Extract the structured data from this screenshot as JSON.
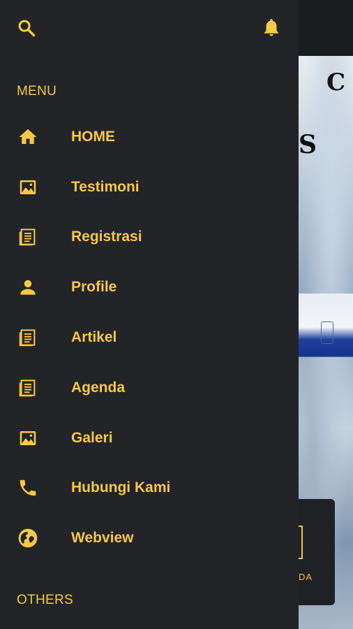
{
  "drawer": {
    "header": {
      "search_icon": "search-icon",
      "notification_icon": "bell-icon"
    },
    "menu_section_title": "MENU",
    "menu_items": [
      {
        "label": "HOME",
        "icon": "home-icon"
      },
      {
        "label": "Testimoni",
        "icon": "image-icon"
      },
      {
        "label": "Registrasi",
        "icon": "article-icon"
      },
      {
        "label": "Profile",
        "icon": "person-icon"
      },
      {
        "label": "Artikel",
        "icon": "article-icon"
      },
      {
        "label": "Agenda",
        "icon": "article-icon"
      },
      {
        "label": "Galeri",
        "icon": "image-icon"
      },
      {
        "label": "Hubungi Kami",
        "icon": "phone-icon"
      },
      {
        "label": "Webview",
        "icon": "globe-icon"
      }
    ],
    "others_section_title": "OTHERS"
  },
  "background": {
    "hero_letter_top": "C",
    "hero_letter_mid": "S",
    "card_text": "DA"
  },
  "colors": {
    "accent": "#f6c944",
    "drawer_bg": "#222427",
    "app_bg": "#1d1f22"
  }
}
